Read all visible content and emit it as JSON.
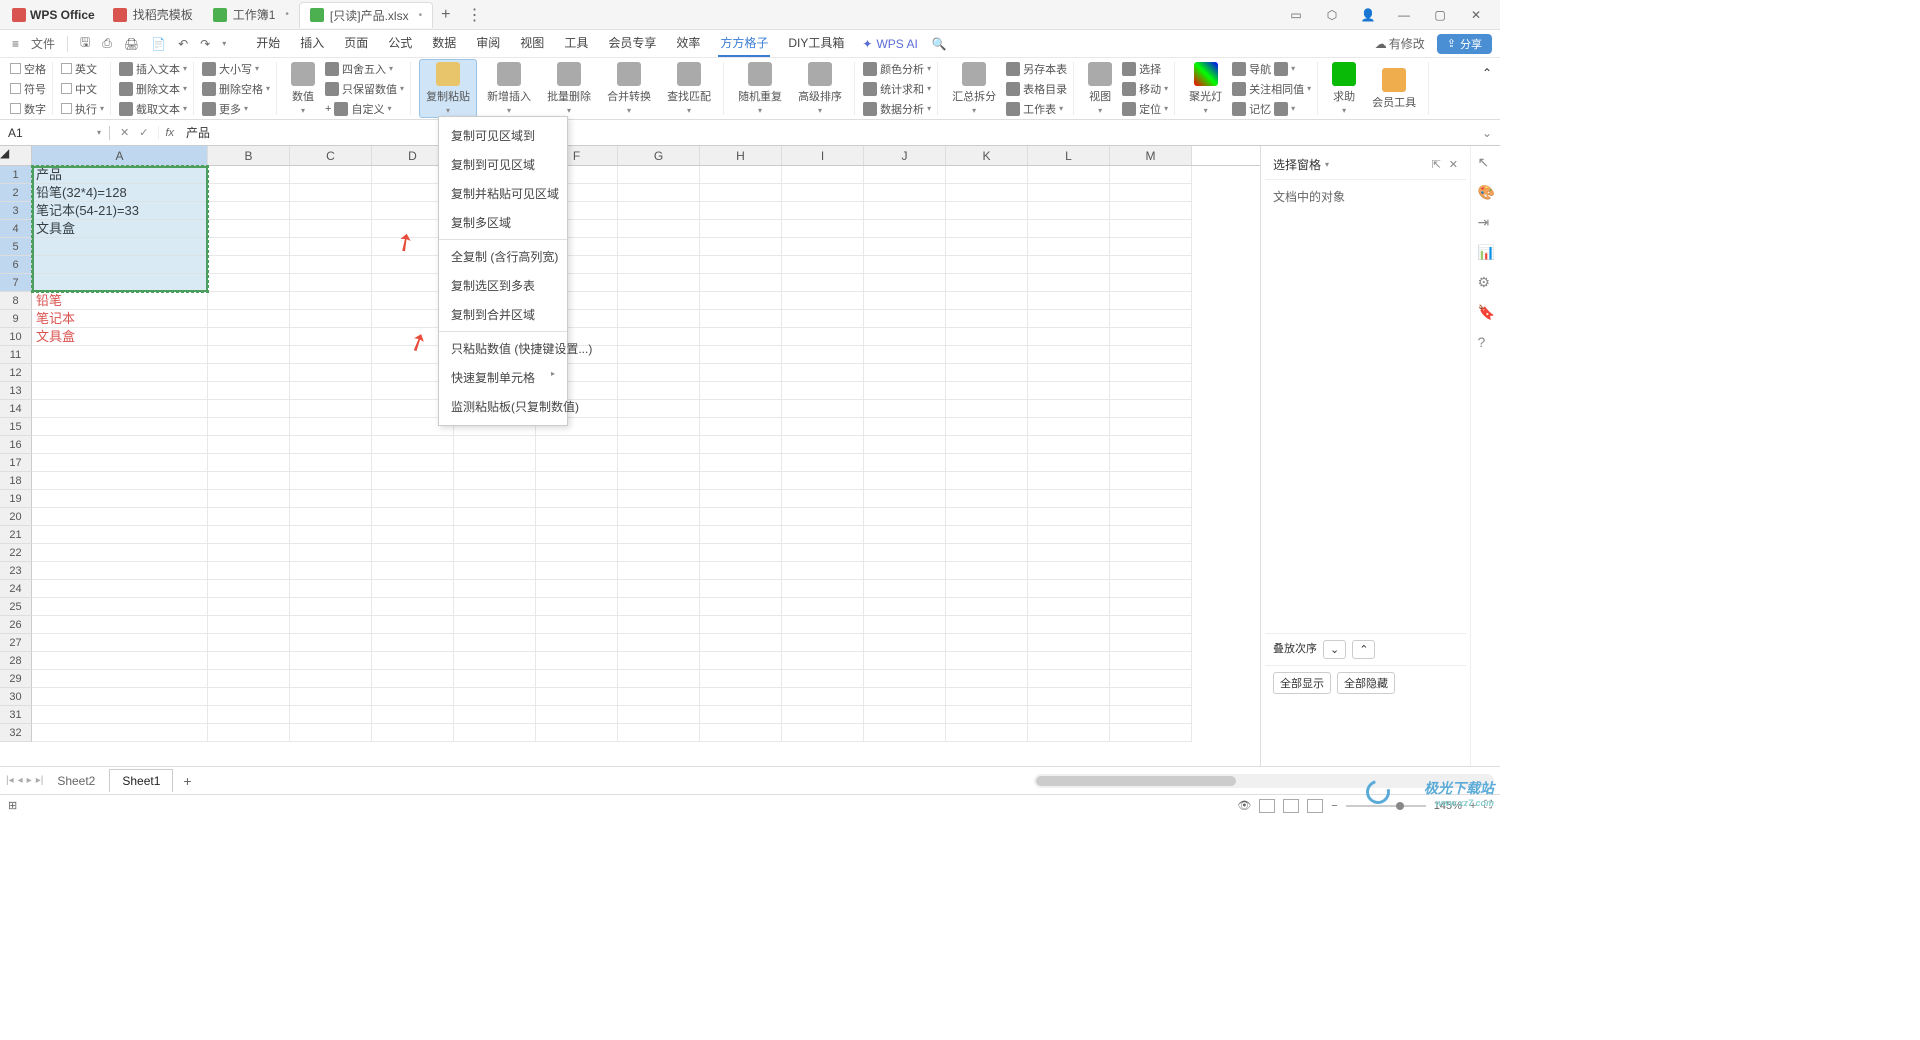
{
  "brand": "WPS Office",
  "tabs": [
    {
      "label": "找稻壳模板",
      "iconColor": "red"
    },
    {
      "label": "工作簿1",
      "iconColor": "green"
    },
    {
      "label": "[只读]产品.xlsx",
      "iconColor": "green",
      "active": true
    }
  ],
  "quickAccess": {
    "fileMenu": "文件",
    "modifyStatus": "有修改",
    "shareBtn": "分享"
  },
  "menuTabs": [
    "开始",
    "插入",
    "页面",
    "公式",
    "数据",
    "审阅",
    "视图",
    "工具",
    "会员专享",
    "效率",
    "方方格子",
    "DIY工具箱"
  ],
  "menuActive": "方方格子",
  "wpsAI": "WPS AI",
  "ribbon": {
    "checkboxes1": [
      "空格",
      "符号",
      "数字"
    ],
    "checkboxes2": [
      "英文",
      "中文",
      "执行"
    ],
    "textOps": [
      "插入文本",
      "删除文本",
      "截取文本"
    ],
    "caseOps": [
      "大小写",
      "删除空格",
      "更多"
    ],
    "numOps": [
      "数值",
      "四舍五入",
      "只保留数值",
      "自定义"
    ],
    "copyPaste": "复制粘贴",
    "insertNew": "新增插入",
    "batchDel": "批量删除",
    "mergeConv": "合并转换",
    "findMatch": "查找匹配",
    "randRepeat": "随机重复",
    "advSort": "高级排序",
    "colorAnalysis": "颜色分析",
    "statSum": "统计求和",
    "dataAnalysis": "数据分析",
    "splitMerge": "汇总拆分",
    "saveTable": "另存本表",
    "tableToc": "表格目录",
    "worksheet": "工作表",
    "view": "视图",
    "select": "选择",
    "move": "移动",
    "locate": "定位",
    "spotlight": "聚光灯",
    "navigate": "导航",
    "watchSame": "关注相同值",
    "remember": "记忆",
    "help": "求助",
    "memberTools": "会员工具"
  },
  "formulaBar": {
    "nameBox": "A1",
    "fx": "fx",
    "value": "产品"
  },
  "columns": [
    "A",
    "B",
    "C",
    "D",
    "E",
    "F",
    "G",
    "H",
    "I",
    "J",
    "K",
    "L",
    "M"
  ],
  "cellData": {
    "A1": "产品",
    "A2": "铅笔(32*4)=128",
    "A3": "笔记本(54-21)=33",
    "A4": "文具盒",
    "A8": "铅笔",
    "A9": "笔记本",
    "A10": "文具盒"
  },
  "selectedRows": [
    1,
    2,
    3,
    4,
    5,
    6,
    7,
    8,
    9,
    10
  ],
  "rowCount": 32,
  "dropdown": {
    "items": [
      "复制可见区域到",
      "复制到可见区域",
      "复制并粘贴可见区域",
      "复制多区域",
      "|",
      "全复制 (含行高列宽)",
      "复制选区到多表",
      "复制到合并区域",
      "|",
      "只粘贴数值 (快捷键设置...)",
      "快速复制单元格 >",
      "监测粘贴板(只复制数值)"
    ]
  },
  "rightPanel": {
    "title": "选择窗格",
    "sub": "文档中的对象",
    "stackOrder": "叠放次序",
    "showAll": "全部显示",
    "hideAll": "全部隐藏"
  },
  "sheets": [
    "Sheet2",
    "Sheet1"
  ],
  "activeSheet": "Sheet1",
  "statusBar": {
    "zoom": "145%"
  },
  "watermark": {
    "name": "极光下载站",
    "url": "www.xz7.com"
  }
}
